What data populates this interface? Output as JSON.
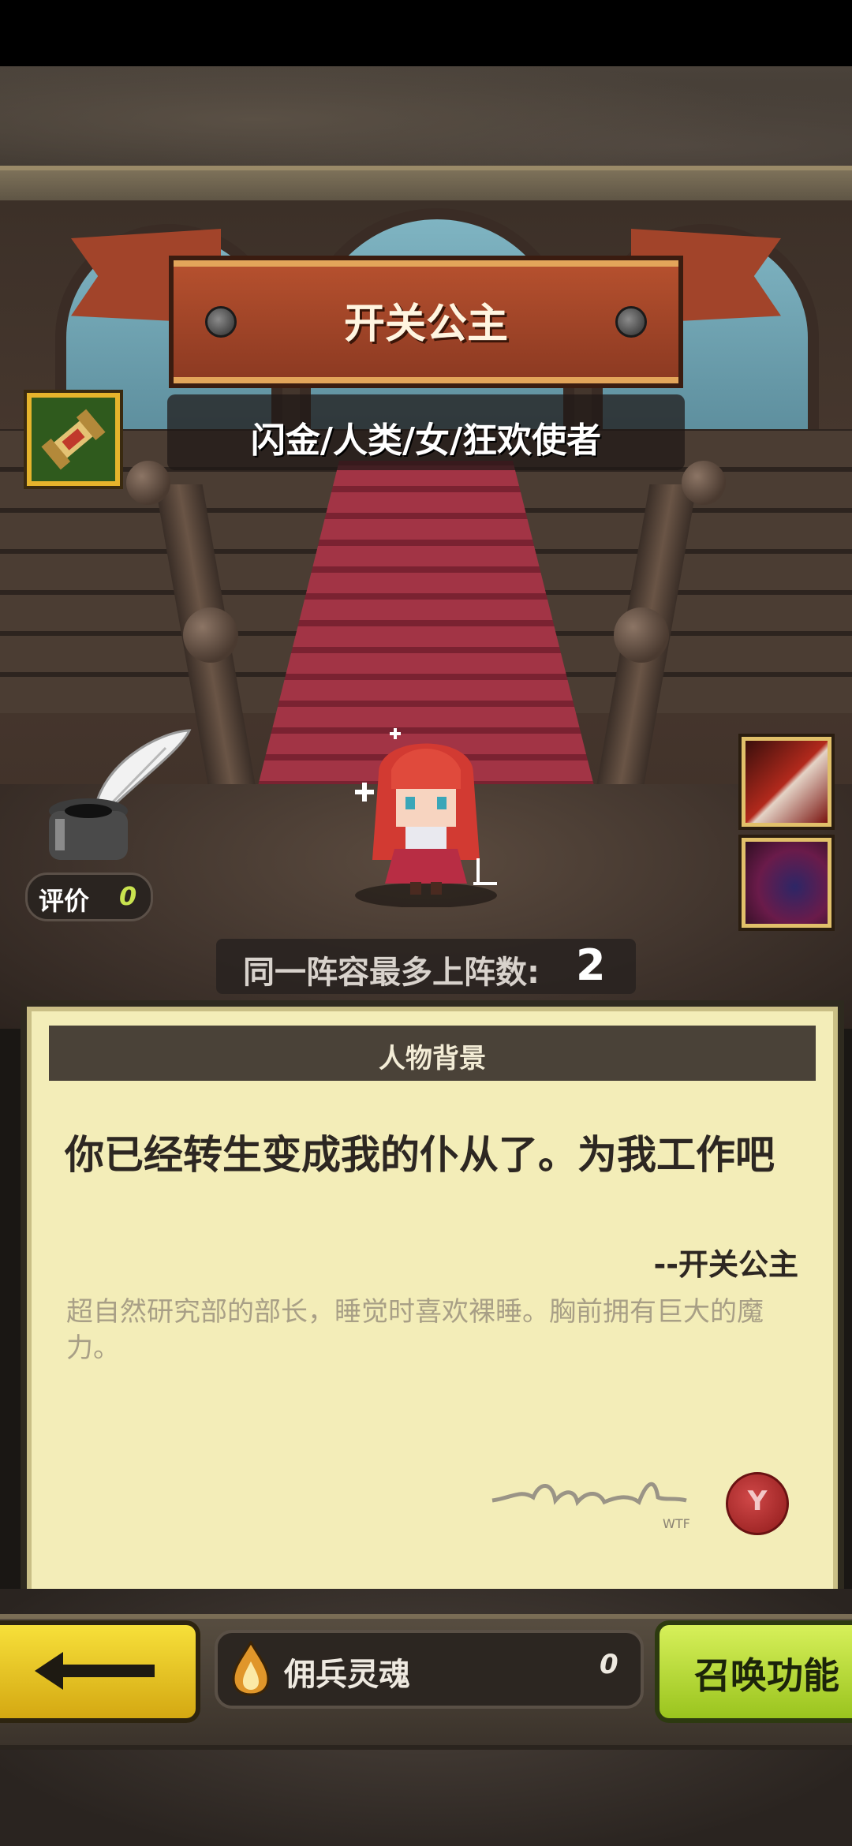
{
  "hero": {
    "name": "开关公主",
    "traits": "闪金/人类/女/狂欢使者",
    "rating_label": "评价",
    "rating_value": "0",
    "max_deploy_label": "同一阵容最多上阵数:",
    "max_deploy_value": "2"
  },
  "background": {
    "header": "人物背景",
    "quote": "你已经转生变成我的仆从了。为我工作吧",
    "quote_attribution": "--开关公主",
    "description": "超自然研究部的部长，睡觉时喜欢裸睡。胸前拥有巨大的魔力。",
    "signature_caption": "WTF",
    "seal_mark": "Y"
  },
  "footer": {
    "soul_label": "佣兵灵魂",
    "soul_value": "0",
    "summon_label": "召唤功能"
  },
  "icons": {
    "scroll": "scroll-icon",
    "quill": "quill-ink-icon",
    "skill_1": "sword-slash-skill-icon",
    "skill_2": "dark-wing-skill-icon",
    "back": "left-arrow-icon",
    "soul": "soul-flame-icon"
  },
  "colors": {
    "banner": "#a2442a",
    "parchment": "#f3edb8",
    "back_button": "#f7e03a",
    "summon_button": "#b6dc2e",
    "rating_value": "#c9e34f"
  }
}
